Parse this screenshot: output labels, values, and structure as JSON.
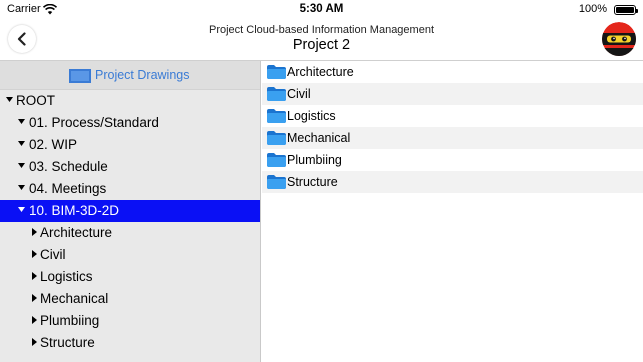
{
  "status_bar": {
    "carrier": "Carrier",
    "time": "5:30 AM",
    "battery": "100%"
  },
  "header": {
    "subtitle": "Project Cloud-based Information Management",
    "title": "Project 2",
    "back_icon": "chevron-left-icon",
    "avatar_icon": "ninja-avatar-icon"
  },
  "sidebar": {
    "header_label": "Project Drawings",
    "tree": [
      {
        "label": "ROOT",
        "expanded": true
      },
      {
        "label": "01. Process/Standard",
        "expanded": true
      },
      {
        "label": "02. WIP",
        "expanded": true
      },
      {
        "label": "03. Schedule",
        "expanded": true
      },
      {
        "label": "04. Meetings",
        "expanded": true
      },
      {
        "label": "10. BIM-3D-2D",
        "expanded": true,
        "selected": true
      },
      {
        "label": "Architecture",
        "expanded": false
      },
      {
        "label": "Civil",
        "expanded": false
      },
      {
        "label": "Logistics",
        "expanded": false
      },
      {
        "label": "Mechanical",
        "expanded": false
      },
      {
        "label": "Plumbiing",
        "expanded": false
      },
      {
        "label": "Structure",
        "expanded": false
      }
    ]
  },
  "content": {
    "folders": [
      "Architecture",
      "Civil",
      "Logistics",
      "Mechanical",
      "Plumbiing",
      "Structure"
    ]
  },
  "colors": {
    "selection": "#0a10f5",
    "accent": "#3a7bd5",
    "folder": "#2f8fe6"
  }
}
